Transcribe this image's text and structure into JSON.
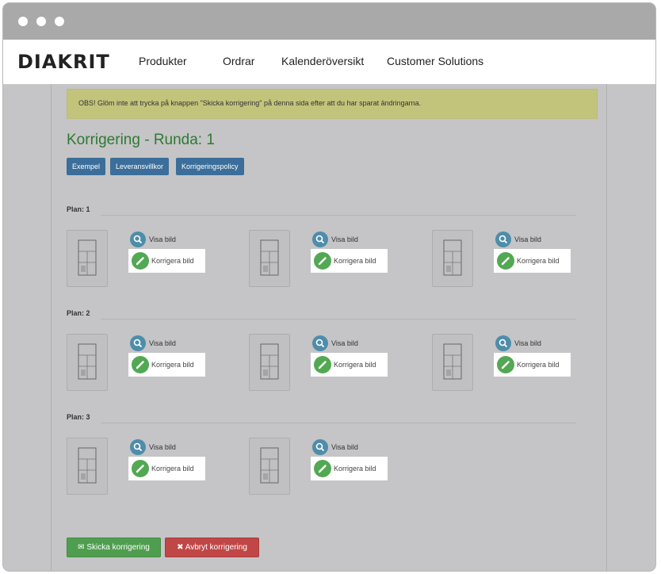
{
  "nav": {
    "logo": "DIAKRIT",
    "items": [
      "Produkter",
      "Ordrar",
      "Kalenderöversikt",
      "Customer Solutions"
    ]
  },
  "alert": {
    "text": "OBS! Glöm inte att trycka på knappen \"Skicka korrigering\" på denna sida efter att du har sparat ändringarna."
  },
  "page": {
    "title": "Korrigering - Runda: 1",
    "tabs": [
      "Exempel",
      "Leveransvillkor",
      "Korrigeringspolicy"
    ]
  },
  "plans": [
    {
      "label": "Plan: 1",
      "images": 3
    },
    {
      "label": "Plan: 2",
      "images": 3
    },
    {
      "label": "Plan: 3",
      "images": 2
    }
  ],
  "actions": {
    "view_label": "Visa bild",
    "edit_label": "Korrigera bild",
    "submit_label": "Skicka korrigering",
    "cancel_label": "Avbryt korrigering"
  },
  "colors": {
    "title_green": "#2e7a33",
    "tab_blue": "#3b6e9a",
    "view_blue": "#4e8daa",
    "edit_green": "#53a853",
    "submit_green": "#4f9e4f",
    "cancel_red": "#c14646",
    "alert_yellow": "#c3c47c"
  }
}
